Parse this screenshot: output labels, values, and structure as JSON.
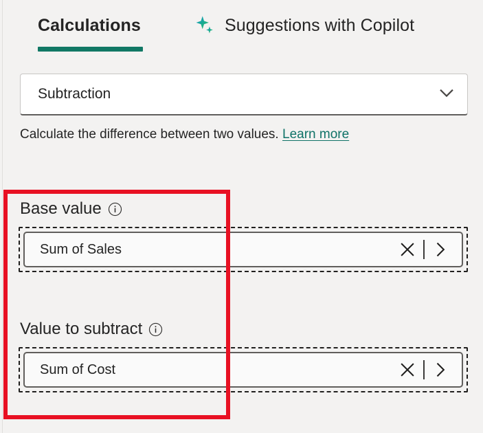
{
  "panel": {
    "background_color": "#f3f2f1",
    "accent_color": "#117865",
    "annotation_color": "#e81123"
  },
  "tabs": [
    {
      "id": "calculations",
      "label": "Calculations",
      "selected": true,
      "icon": null
    },
    {
      "id": "suggestions-with-copilot",
      "label": "Suggestions with Copilot",
      "selected": false,
      "icon": "copilot-sparkle-icon"
    }
  ],
  "calculation_type": {
    "selected": "Subtraction",
    "chevron_icon": "chevron-down-icon"
  },
  "description": {
    "text": "Calculate the difference between two values.",
    "link_label": "Learn more",
    "link_color": "#0f7267"
  },
  "fields": [
    {
      "id": "base-value",
      "label": "Base value",
      "info_icon": "info-icon",
      "value": "Sum of Sales",
      "clear_icon": "clear-icon",
      "expand_icon": "chevron-right-icon",
      "focused": true
    },
    {
      "id": "value-to-subtract",
      "label": "Value to subtract",
      "info_icon": "info-icon",
      "value": "Sum of Cost",
      "clear_icon": "clear-icon",
      "expand_icon": "chevron-right-icon",
      "focused": true
    }
  ]
}
